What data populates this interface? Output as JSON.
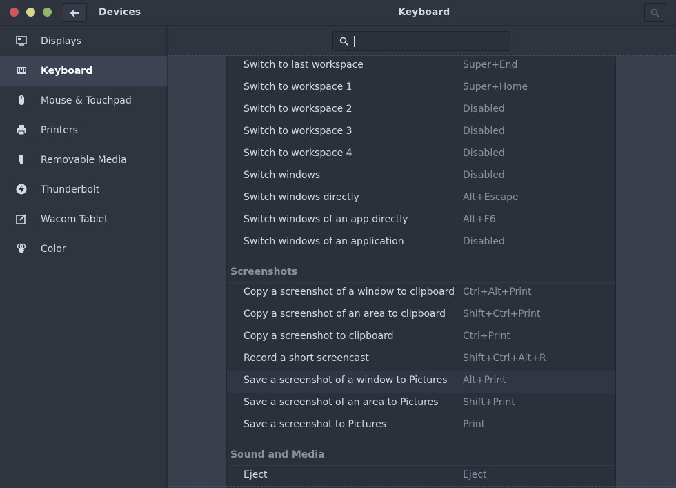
{
  "titlebar": {
    "left_title": "Devices",
    "title": "Keyboard"
  },
  "sidebar": {
    "items": [
      {
        "label": "Displays",
        "icon": "display-icon"
      },
      {
        "label": "Keyboard",
        "icon": "keyboard-icon",
        "active": true
      },
      {
        "label": "Mouse & Touchpad",
        "icon": "mouse-icon"
      },
      {
        "label": "Printers",
        "icon": "printer-icon"
      },
      {
        "label": "Removable Media",
        "icon": "usb-drive-icon"
      },
      {
        "label": "Thunderbolt",
        "icon": "thunderbolt-icon"
      },
      {
        "label": "Wacom Tablet",
        "icon": "tablet-icon"
      },
      {
        "label": "Color",
        "icon": "color-icon"
      }
    ]
  },
  "search": {
    "placeholder": ""
  },
  "shortcuts": {
    "navigation": [
      {
        "name": "Switch to last workspace",
        "accel": "Super+End"
      },
      {
        "name": "Switch to workspace 1",
        "accel": "Super+Home"
      },
      {
        "name": "Switch to workspace 2",
        "accel": "Disabled"
      },
      {
        "name": "Switch to workspace 3",
        "accel": "Disabled"
      },
      {
        "name": "Switch to workspace 4",
        "accel": "Disabled"
      },
      {
        "name": "Switch windows",
        "accel": "Disabled"
      },
      {
        "name": "Switch windows directly",
        "accel": "Alt+Escape"
      },
      {
        "name": "Switch windows of an app directly",
        "accel": "Alt+F6"
      },
      {
        "name": "Switch windows of an application",
        "accel": "Disabled"
      }
    ],
    "screenshots_title": "Screenshots",
    "screenshots": [
      {
        "name": "Copy a screenshot of a window to clipboard",
        "accel": "Ctrl+Alt+Print"
      },
      {
        "name": "Copy a screenshot of an area to clipboard",
        "accel": "Shift+Ctrl+Print"
      },
      {
        "name": "Copy a screenshot to clipboard",
        "accel": "Ctrl+Print"
      },
      {
        "name": "Record a short screencast",
        "accel": "Shift+Ctrl+Alt+R"
      },
      {
        "name": "Save a screenshot of a window to Pictures",
        "accel": "Alt+Print",
        "highlighted": true
      },
      {
        "name": "Save a screenshot of an area to Pictures",
        "accel": "Shift+Print"
      },
      {
        "name": "Save a screenshot to Pictures",
        "accel": "Print"
      }
    ],
    "media_title": "Sound and Media",
    "media": [
      {
        "name": "Eject",
        "accel": "Eject"
      }
    ]
  },
  "colors": {
    "close": "#cc575d",
    "minimize": "#d7d787",
    "maximize": "#8fb86e",
    "sidebar_active": "#3d4353"
  }
}
